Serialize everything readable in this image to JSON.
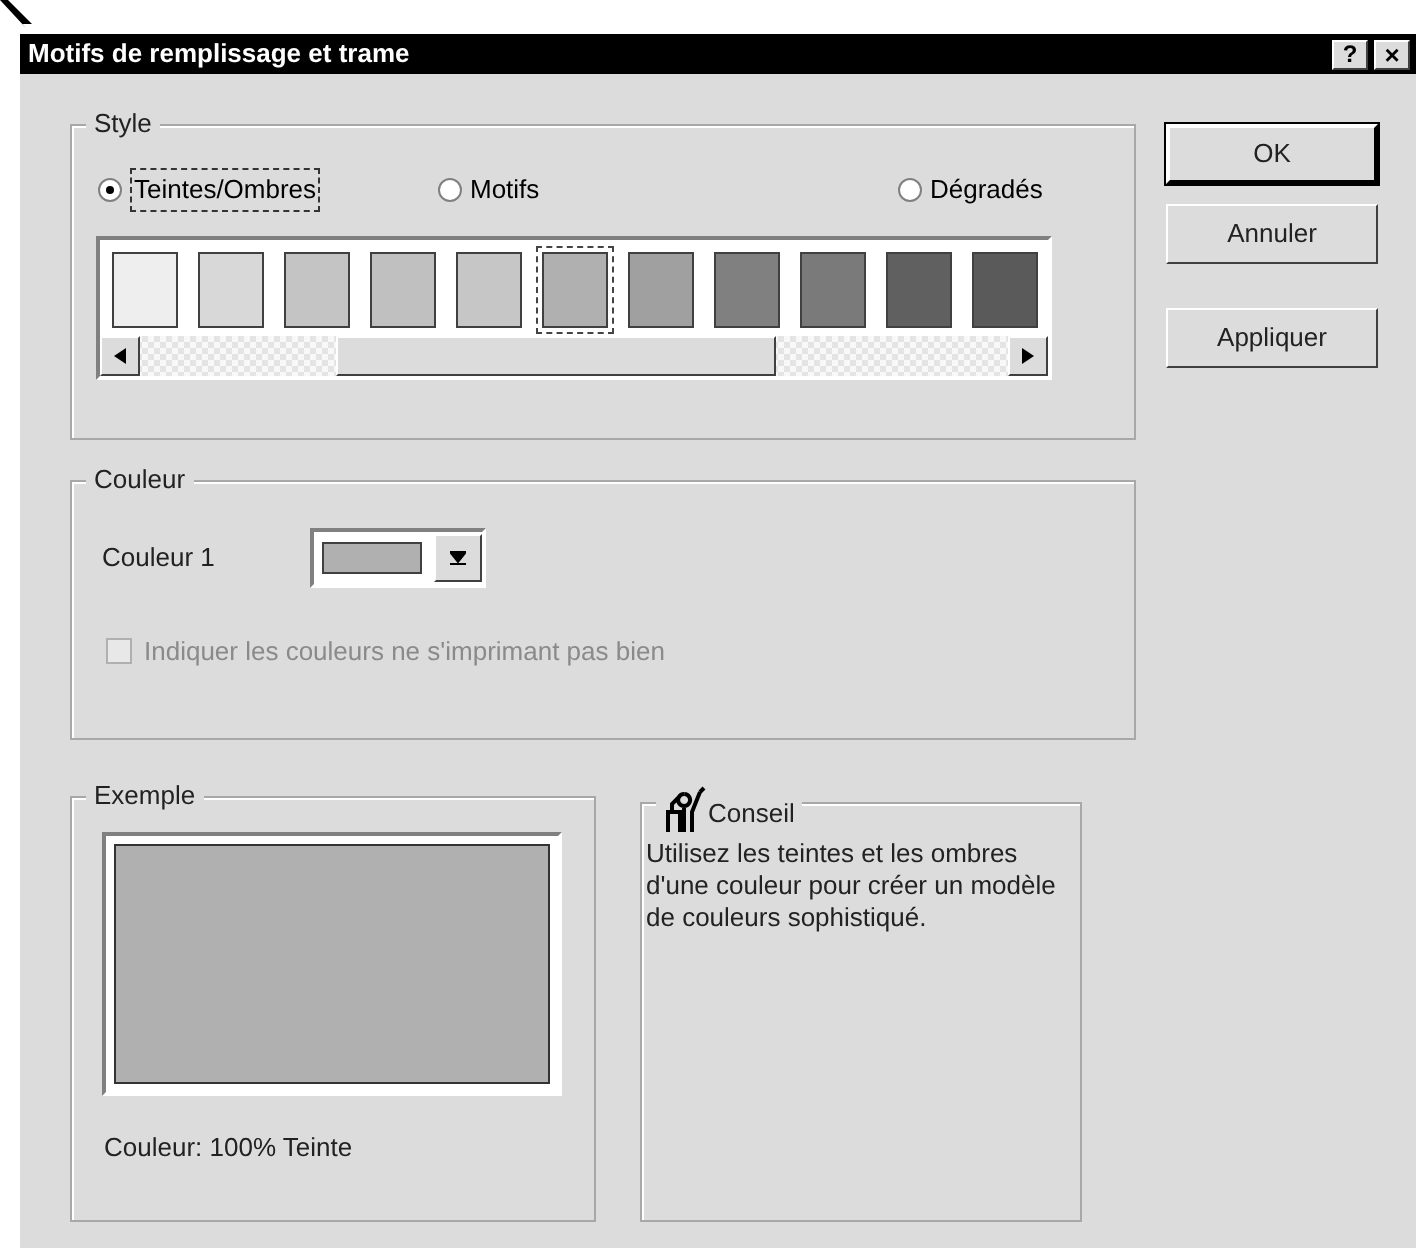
{
  "window": {
    "title": "Motifs de remplissage et trame",
    "help_button": "?",
    "close_button": "×"
  },
  "style_group": {
    "label": "Style",
    "options": [
      {
        "label": "Teintes/Ombres",
        "selected": true
      },
      {
        "label": "Motifs",
        "selected": false
      },
      {
        "label": "Dégradés",
        "selected": false
      }
    ],
    "swatches": [
      {
        "color": "#eeeeee",
        "selected": false
      },
      {
        "color": "#d8d8d8",
        "selected": false
      },
      {
        "color": "#c4c4c4",
        "selected": false
      },
      {
        "color": "#c0c0c0",
        "selected": false
      },
      {
        "color": "#c6c6c6",
        "selected": false
      },
      {
        "color": "#b0b0b0",
        "selected": true
      },
      {
        "color": "#a0a0a0",
        "selected": false
      },
      {
        "color": "#808080",
        "selected": false
      },
      {
        "color": "#7a7a7a",
        "selected": false
      },
      {
        "color": "#606060",
        "selected": false
      },
      {
        "color": "#5a5a5a",
        "selected": false
      }
    ]
  },
  "color_group": {
    "label": "Couleur",
    "color_label": "Couleur 1",
    "checkbox": {
      "label": "Indiquer les couleurs ne s'imprimant pas bien",
      "checked": false,
      "disabled": true
    }
  },
  "example_group": {
    "label": "Exemple",
    "caption": "Couleur: 100% Teinte"
  },
  "tip_group": {
    "label": "Conseil",
    "text": "Utilisez les teintes et les ombres d'une couleur pour créer un modèle de couleurs sophistiqué."
  },
  "buttons": [
    {
      "label": "OK",
      "default": true
    },
    {
      "label": "Annuler",
      "default": false
    },
    {
      "label": "Appliquer",
      "default": false
    }
  ]
}
